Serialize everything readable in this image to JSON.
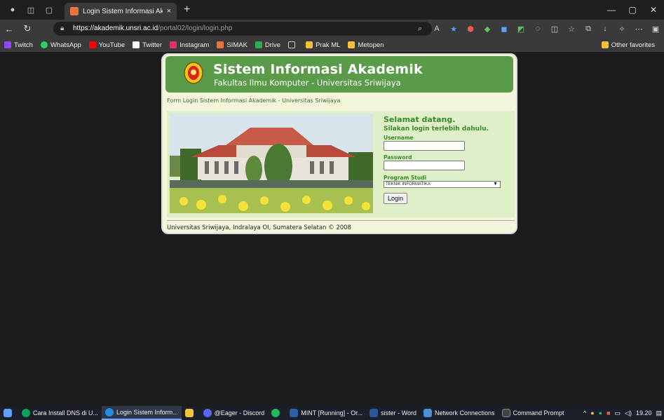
{
  "browser": {
    "tab_title": "Login Sistem Informasi Akademik",
    "tab_close": "×",
    "new_tab": "+",
    "url_host": "https://akademik.unsri.ac.id",
    "url_path": "/portal02/login/login.php",
    "window_controls": [
      "—",
      "▢",
      "✕"
    ],
    "bookmarks": [
      {
        "label": "Twitch",
        "color": "#9146ff"
      },
      {
        "label": "WhatsApp",
        "color": "#25d366"
      },
      {
        "label": "YouTube",
        "color": "#ff0000"
      },
      {
        "label": "Twitter",
        "color": "#ffffff"
      },
      {
        "label": "Instagram",
        "color": "#e1306c"
      },
      {
        "label": "SIMAK",
        "color": "#e8743b"
      },
      {
        "label": "Drive",
        "color": "#34a853"
      },
      {
        "label": "Prak ML",
        "color": "#f3c13a"
      },
      {
        "label": "Metopen",
        "color": "#f3c13a"
      }
    ],
    "other_favorites": "Other favorites"
  },
  "page": {
    "title": "Sistem Informasi Akademik",
    "subtitle": "Fakultas Ilmu Komputer - Universitas Sriwijaya",
    "form_label": "Form Login Sistem Informasi Akademik - Universitas Sriwijaya",
    "welcome_heading": "Selamat datang.",
    "welcome_sub": "Silakan login terlebih dahulu.",
    "username_label": "Username",
    "username_value": "",
    "password_label": "Password",
    "password_value": "",
    "program_label": "Program Studi",
    "program_value": "TEKNIK INFORMATIKA",
    "login_button": "Login",
    "footer": "Universitas Sriwijaya, Indralaya OI, Sumatera Selatan © 2008"
  },
  "taskbar": {
    "items": [
      {
        "label": "Cara Install DNS di U...",
        "color": "#0f9d58",
        "active": false
      },
      {
        "label": "Login Sistem Inform...",
        "color": "#1e8fe0",
        "active": true
      },
      {
        "label": "",
        "color": "#f3c13a",
        "active": false
      },
      {
        "label": "@Eager - Discord",
        "color": "#5865f2",
        "active": false
      },
      {
        "label": "",
        "color": "#1db954",
        "active": false
      },
      {
        "label": "MINT [Running] - Or...",
        "color": "#2a5fa8",
        "active": false
      },
      {
        "label": "sister - Word",
        "color": "#2b579a",
        "active": false
      },
      {
        "label": "Network Connections",
        "color": "#4a90d9",
        "active": false
      },
      {
        "label": "Command Prompt",
        "color": "#444444",
        "active": false
      }
    ],
    "time": "19.20"
  }
}
